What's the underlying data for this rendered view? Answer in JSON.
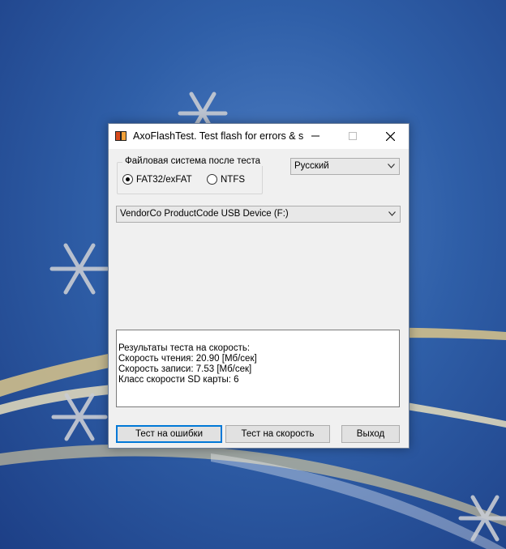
{
  "window": {
    "title": "AxoFlashTest. Test flash for errors & s...",
    "icon": "app-logo-icon"
  },
  "title_buttons": {
    "minimize_icon": "minimize-icon",
    "maximize_icon": "maximize-icon",
    "close_icon": "close-icon"
  },
  "filesystem_group": {
    "legend": "Файловая система после теста",
    "options": [
      {
        "label": "FAT32/exFAT",
        "checked": true
      },
      {
        "label": "NTFS",
        "checked": false
      }
    ]
  },
  "language_select": {
    "value": "Русский"
  },
  "device_select": {
    "value": "VendorCo ProductCode USB Device (F:)"
  },
  "results": {
    "lines": [
      "Результаты теста на скорость:",
      "Скорость чтения: 20.90 [Мб/сек]",
      "Скорость записи: 7.53 [Мб/сек]",
      "Класс скорости SD карты: 6"
    ]
  },
  "buttons": {
    "test_errors": "Тест на ошибки",
    "test_speed": "Тест на скорость",
    "exit": "Выход"
  },
  "colors": {
    "desktop_blue": "#2f5fa8",
    "window_bg": "#f0f0f0",
    "focus_blue": "#0078d7"
  }
}
